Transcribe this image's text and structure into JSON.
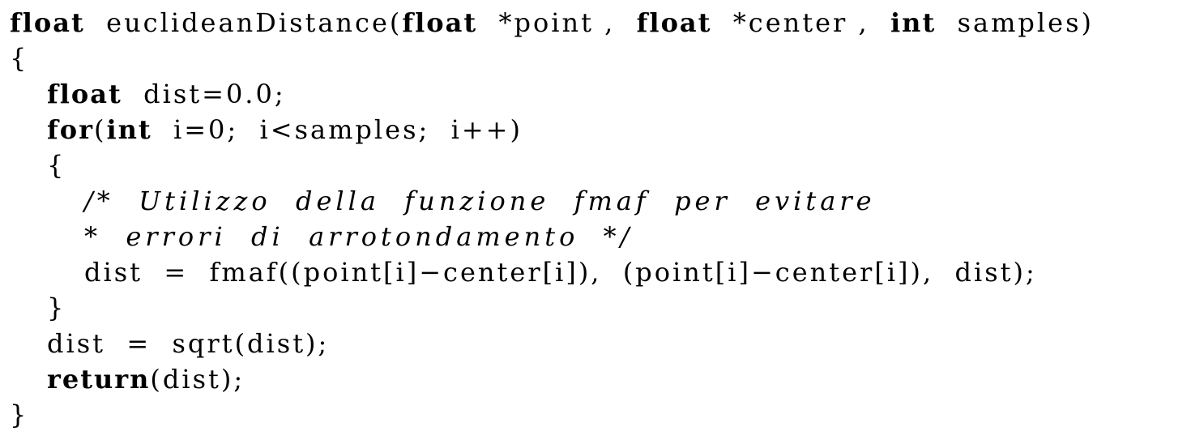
{
  "code": {
    "lines": [
      {
        "indent": 0,
        "segments": [
          {
            "t": "float",
            "k": "kw"
          },
          {
            "t": "  euclideanDistance(",
            "k": "tx"
          },
          {
            "t": "float",
            "k": "kw"
          },
          {
            "t": "  *point ,  ",
            "k": "tx"
          },
          {
            "t": "float",
            "k": "kw"
          },
          {
            "t": "  *center ,  ",
            "k": "tx"
          },
          {
            "t": "int",
            "k": "kw"
          },
          {
            "t": "  samples)",
            "k": "tx"
          }
        ]
      },
      {
        "indent": 0,
        "segments": [
          {
            "t": "{",
            "k": "tx"
          }
        ]
      },
      {
        "indent": 1,
        "segments": [
          {
            "t": "float",
            "k": "kw"
          },
          {
            "t": "  dist=0.0;",
            "k": "tx"
          }
        ]
      },
      {
        "indent": 1,
        "segments": [
          {
            "t": "for",
            "k": "kw"
          },
          {
            "t": "(",
            "k": "tx"
          },
          {
            "t": "int",
            "k": "kw"
          },
          {
            "t": "  i=0;  i<samples;  i++)",
            "k": "tx"
          }
        ]
      },
      {
        "indent": 1,
        "segments": [
          {
            "t": "{",
            "k": "tx"
          }
        ]
      },
      {
        "indent": 2,
        "segments": [
          {
            "t": "/*  Utilizzo  della  funzione  fmaf  per  evitare",
            "k": "cm"
          }
        ]
      },
      {
        "indent": 2,
        "segments": [
          {
            "t": "*  errori  di  arrotondamento  */",
            "k": "cm"
          }
        ]
      },
      {
        "indent": 2,
        "segments": [
          {
            "t": "dist  =  fmaf((point[i]−center[i]),  (point[i]−center[i]),  dist);",
            "k": "tx"
          }
        ]
      },
      {
        "indent": 1,
        "segments": [
          {
            "t": "}",
            "k": "tx"
          }
        ]
      },
      {
        "indent": 1,
        "segments": [
          {
            "t": "dist  =  sqrt(dist);",
            "k": "tx"
          }
        ]
      },
      {
        "indent": 1,
        "segments": [
          {
            "t": "return",
            "k": "kw"
          },
          {
            "t": "(dist);",
            "k": "tx"
          }
        ]
      },
      {
        "indent": 0,
        "segments": [
          {
            "t": "}",
            "k": "tx"
          }
        ]
      }
    ]
  }
}
